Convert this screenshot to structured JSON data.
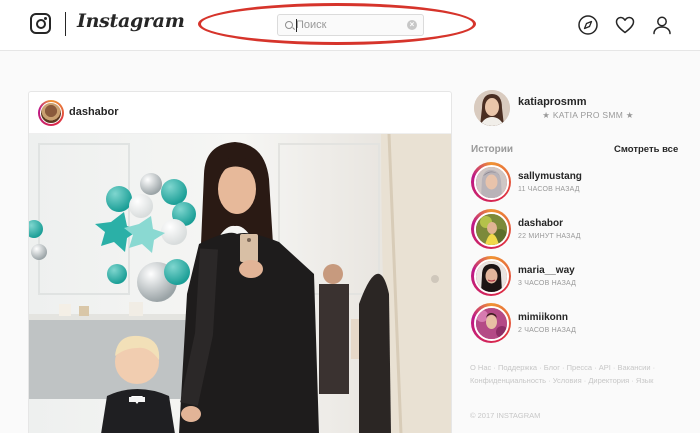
{
  "header": {
    "brand": "Instagram",
    "search": {
      "placeholder": "Поиск",
      "value": ""
    },
    "nav_icons": [
      "compass-icon",
      "heart-icon",
      "person-icon"
    ]
  },
  "post": {
    "username": "dashabor"
  },
  "profile": {
    "username": "katiaprosmm",
    "full_name": "★ KATIA PRO SMM ★"
  },
  "stories": {
    "title": "Истории",
    "see_all": "Смотреть все",
    "items": [
      {
        "username": "sallymustang",
        "time": "11 ЧАСОВ НАЗАД"
      },
      {
        "username": "dashabor",
        "time": "22 МИНУТ НАЗАД"
      },
      {
        "username": "maria__way",
        "time": "3 ЧАСОВ НАЗАД"
      },
      {
        "username": "mimiikonn",
        "time": "2 ЧАСОВ НАЗАД"
      }
    ]
  },
  "footer": {
    "links": [
      "О Нас",
      "Поддержка",
      "Блог",
      "Пресса",
      "API",
      "Вакансии",
      "Конфиденциальность",
      "Условия",
      "Директория",
      "Язык"
    ],
    "copyright": "© 2017 INSTAGRAM"
  },
  "colors": {
    "accent_highlight": "#d6342b",
    "story_ring": "#dc2743",
    "text_primary": "#262626",
    "text_secondary": "#999999"
  }
}
